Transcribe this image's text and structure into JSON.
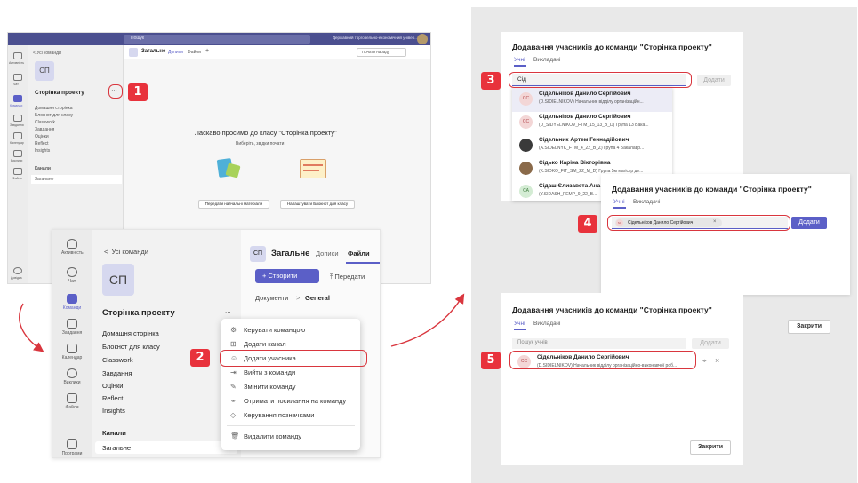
{
  "panel1": {
    "search": "Пошук",
    "account": "Державний торговельно-економічний універ...",
    "back": "Усі команди",
    "avatar": "СП",
    "team_name": "Сторінка проекту",
    "team_items": [
      "Домашня сторінка",
      "Блокнот для класу",
      "Classwork",
      "Завдання",
      "Оцінки",
      "Reflect",
      "Insights"
    ],
    "channels_label": "Канали",
    "channel": "Загальне",
    "tab_title": "Загальне",
    "tabs": [
      "Дописи",
      "Файли"
    ],
    "meet": "Почати нараду",
    "welcome": "Ласкаво просимо до класу \"Сторінка проекту\"",
    "welcome_sub": "Виберіть, звідки почати",
    "btn_upload": "Передати навчальні матеріали",
    "btn_notebook": "Налаштувати Блокнот для класу",
    "rail": [
      "Активність",
      "Чат",
      "Команди",
      "Завдання",
      "Календар",
      "Виклики",
      "Файли"
    ],
    "rail_bottom": "Довідка"
  },
  "panel2": {
    "rail": [
      "Активність",
      "Чат",
      "Команди",
      "Завдання",
      "Календар",
      "Виклики",
      "Файли",
      "Програми"
    ],
    "back": "Усі команди",
    "avatar": "СП",
    "team_name": "Сторінка проекту",
    "more": "...",
    "items": [
      "Домашня сторінка",
      "Блокнот для класу",
      "Classwork",
      "Завдання",
      "Оцінки",
      "Reflect",
      "Insights"
    ],
    "channels_label": "Канали",
    "channel": "Загальне",
    "header_avatar": "СП",
    "header_title": "Загальне",
    "tab_posts": "Дописи",
    "tab_files": "Файли",
    "create": "+ Створити",
    "upload": "Передати",
    "breadcrumb_root": "Документи",
    "breadcrumb_sep": ">",
    "breadcrumb_leaf": "General",
    "menu": [
      "Керувати командою",
      "Додати канал",
      "Додати учасника",
      "Вийти з команди",
      "Змінити команду",
      "Отримати посилання на команду",
      "Керування позначками",
      "Видалити команду"
    ]
  },
  "dialog3": {
    "title": "Додавання учасників до команди \"Сторінка проекту\"",
    "tab_students": "Учні",
    "tab_teachers": "Викладачі",
    "input": "Сід",
    "add": "Додати",
    "people": [
      {
        "initials": "СС",
        "name": "Сідельніков Данило Сергійович",
        "desc": "(D.SIDIELNIKOV) Начальник відділу організаційн..."
      },
      {
        "initials": "СС",
        "name": "Сідельніков Данило Сергійович",
        "desc": "(D_SIDYELNIKOV_FTM_15_13_B_D) Група 13 Бака..."
      },
      {
        "initials": "",
        "name": "Сідельник Артем Геннадійович",
        "desc": "(A.SIDELNYK_FTM_4_22_B_Z) Група 4 Бакалавр..."
      },
      {
        "initials": "",
        "name": "Сідько Каріна Вікторівна",
        "desc": "(K.SIDKO_FIT_SM_22_M_D) Група 5м магістр де..."
      },
      {
        "initials": "СА",
        "name": "Сідаш Єлизавета Ана",
        "desc": "(Y.SIDASH_FEMP_9_22_B..."
      }
    ]
  },
  "dialog4": {
    "title": "Додавання учасників до команди \"Сторінка проекту\"",
    "tab_students": "Учні",
    "tab_teachers": "Викладачі",
    "chip": "Сідельніков Данило Сергійович",
    "chip_initials": "SC",
    "add": "Додати"
  },
  "dialog5": {
    "title": "Додавання учасників до команди \"Сторінка проекту\"",
    "tab_students": "Учні",
    "tab_teachers": "Викладачі",
    "placeholder": "Пошук учнів",
    "add": "Додати",
    "close": "Закрити",
    "person_initials": "СС",
    "person_name": "Сідельніков Данило Сергійович",
    "person_desc": "(D.SIDIELNIKOV) Начальник відділу організаційно-виконавчої роб..."
  },
  "close_side": "Закрити",
  "badges": [
    "1",
    "2",
    "3",
    "4",
    "5"
  ],
  "colors": {
    "accent": "#5b5fc7",
    "badge": "#e8323c",
    "titlebar": "#4b4f8f"
  }
}
